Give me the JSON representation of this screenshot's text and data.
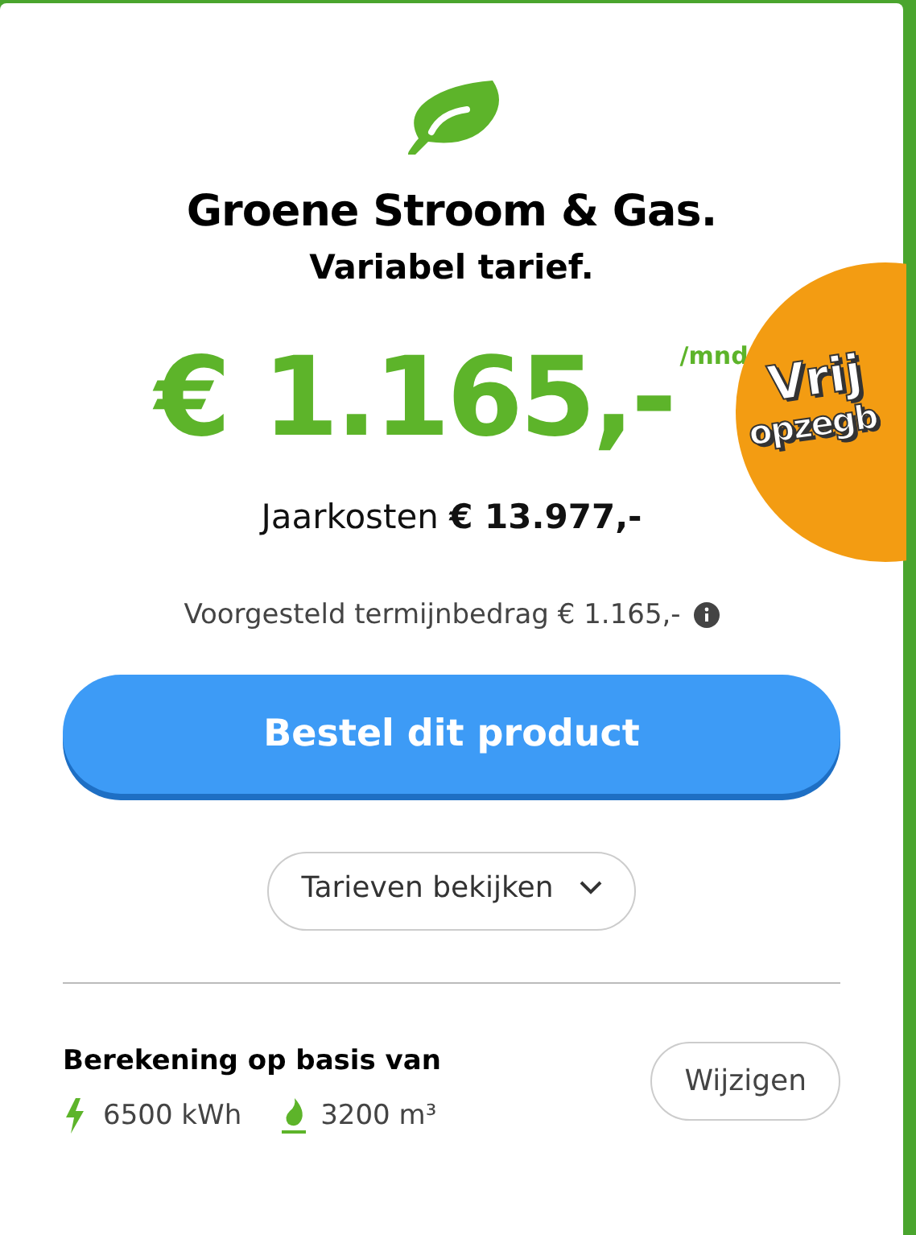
{
  "product": {
    "title": "Groene Stroom & Gas.",
    "subtitle": "Variabel tarief."
  },
  "price": {
    "amount": "€ 1.165,-",
    "unit": "/mnd"
  },
  "sticker": {
    "line_1": "Vrij",
    "line_2": "opzegb"
  },
  "annual": {
    "label": "Jaarkosten",
    "amount": "€ 13.977,-"
  },
  "installment": {
    "text": "Voorgesteld termijnbedrag € 1.165,-"
  },
  "order_button": "Bestel dit product",
  "rates_button": "Tarieven bekijken",
  "calculation": {
    "title": "Berekening op basis van",
    "change_button": "Wijzigen",
    "usages": [
      {
        "kind": "electricity",
        "value": "6500 kWh"
      },
      {
        "kind": "gas",
        "value": "3200 m³"
      }
    ]
  }
}
